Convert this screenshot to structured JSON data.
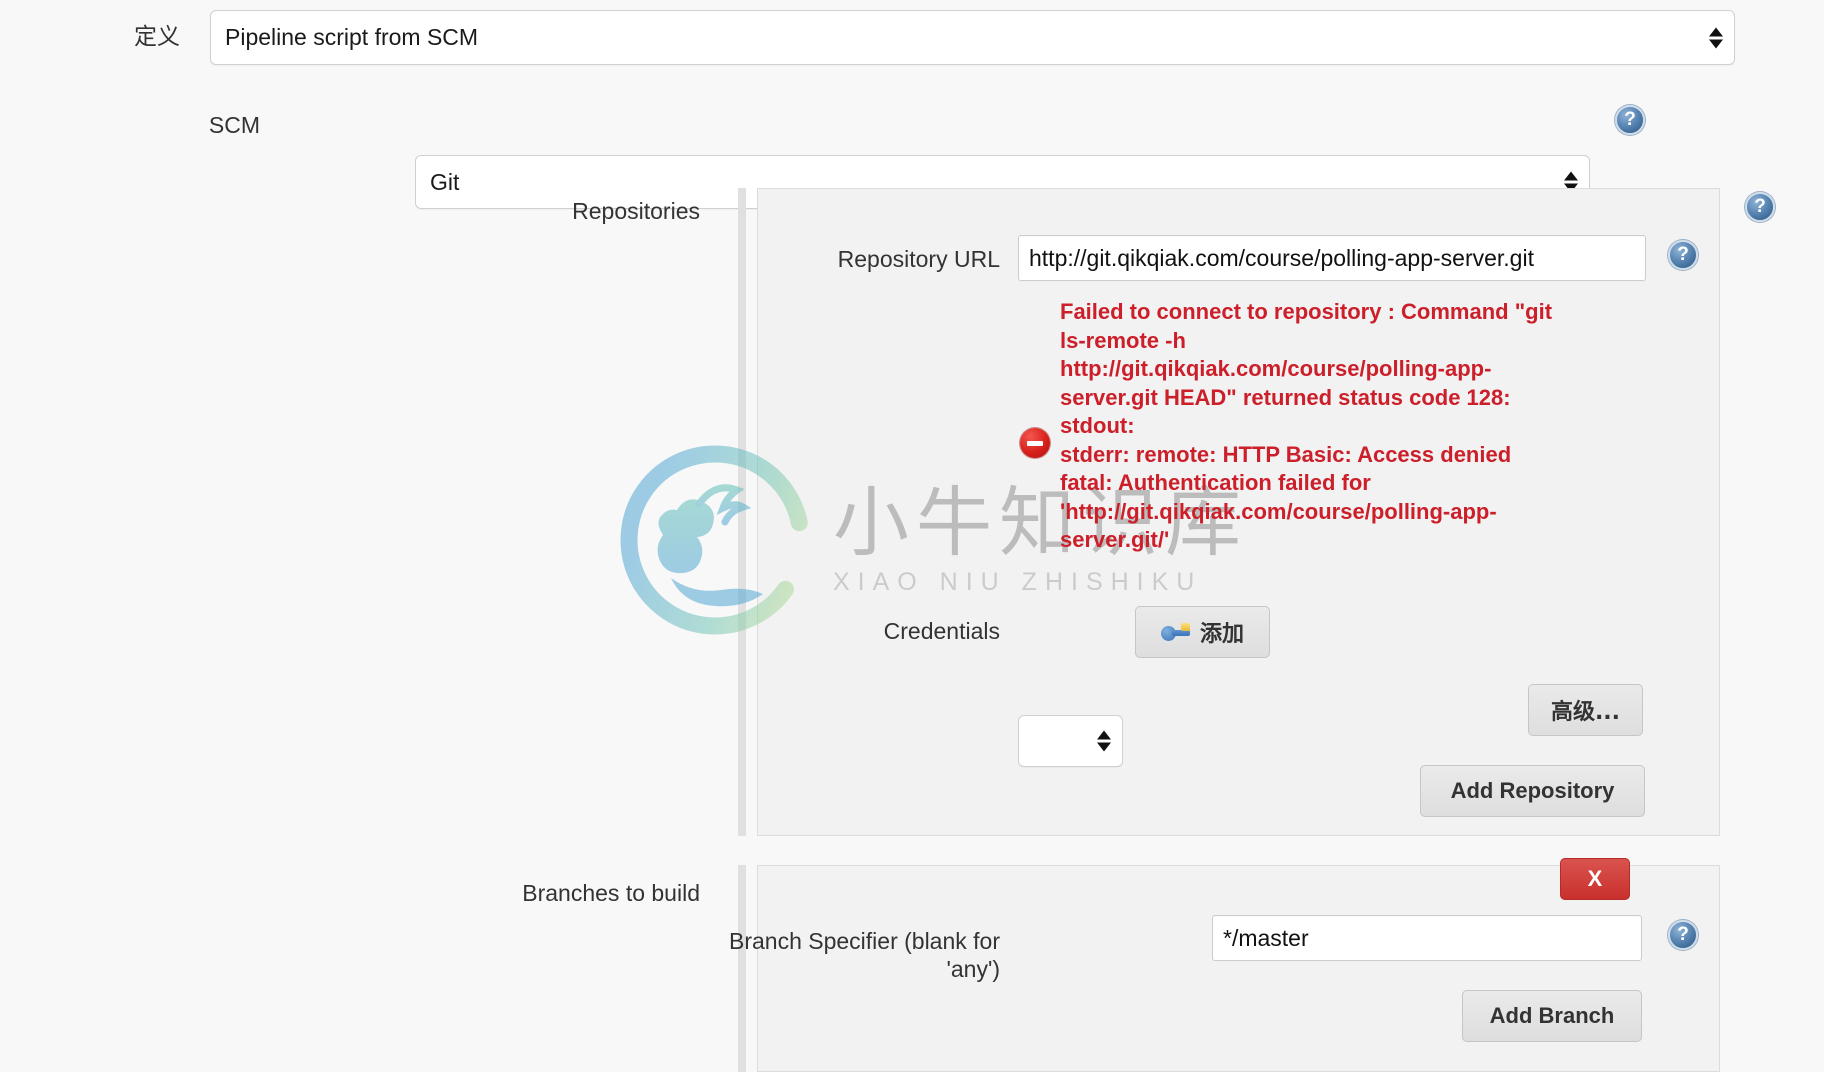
{
  "form": {
    "definition": {
      "label": "定义",
      "value": "Pipeline script from SCM"
    },
    "scm": {
      "label": "SCM",
      "value": "Git",
      "help_icon": "help-icon"
    },
    "repositories": {
      "label": "Repositories",
      "help_icon": "help-icon",
      "repository_url": {
        "label": "Repository URL",
        "value": "http://git.qikqiak.com/course/polling-app-server.git",
        "help_icon": "help-icon"
      },
      "error": {
        "icon": "error-stop-icon",
        "lines": [
          "Failed to connect to repository : Command \"git ls-remote -h http://git.qikqiak.com/course/polling-app-server.git HEAD\" returned status code 128:",
          "stdout:",
          "stderr: remote: HTTP Basic: Access denied",
          "fatal: Authentication failed for 'http://git.qikqiak.com/course/polling-app-server.git/'"
        ]
      },
      "credentials": {
        "label": "Credentials",
        "value": "",
        "add_button": {
          "label": "添加",
          "icon": "key-icon"
        }
      },
      "advanced_button": "高级...",
      "add_repository_button": "Add Repository"
    },
    "branches": {
      "label": "Branches to build",
      "delete_button": "X",
      "branch_specifier": {
        "label": "Branch Specifier (blank for 'any')",
        "value": "*/master",
        "help_icon": "help-icon"
      },
      "add_branch_button": "Add Branch"
    }
  },
  "watermark": {
    "cn": "小牛知识库",
    "en": "XIAO NIU ZHISHIKU"
  },
  "colors": {
    "error_red": "#cc1f2a",
    "delete_red": "#c9302c",
    "help_blue": "#3f6b99"
  }
}
